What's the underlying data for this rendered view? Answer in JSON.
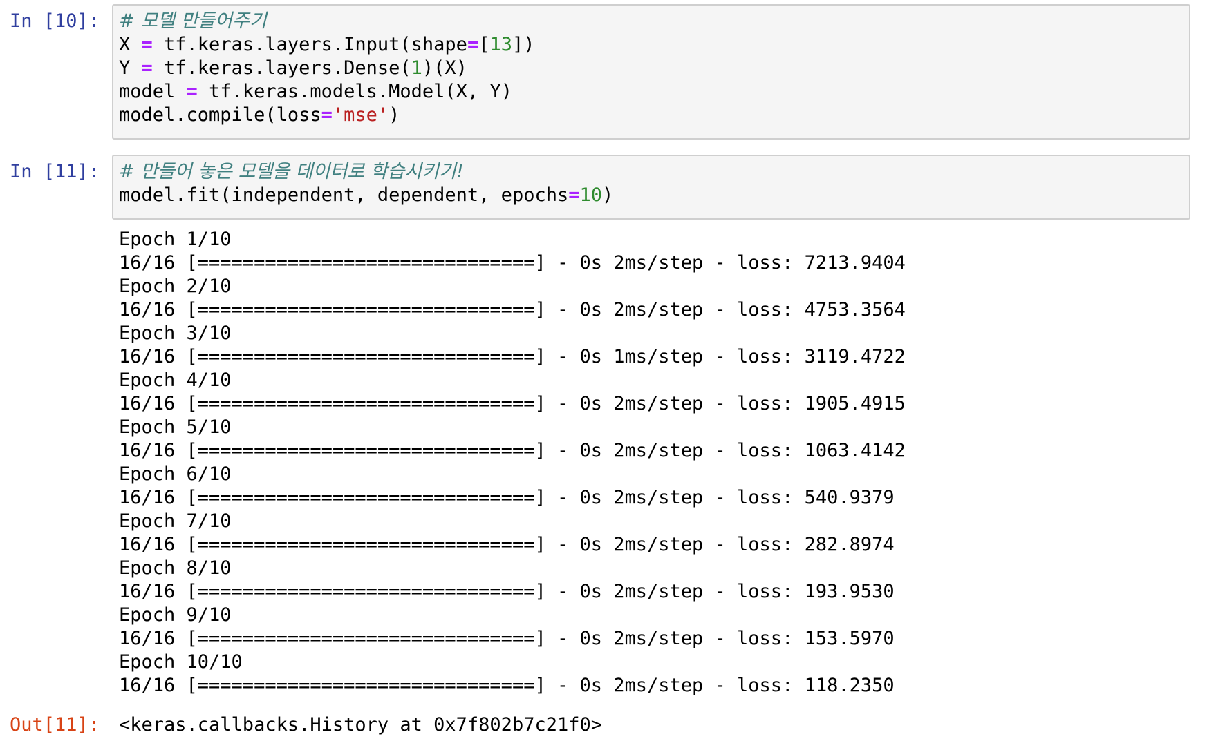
{
  "cells": [
    {
      "prompt": "In [10]:",
      "lines": [
        [
          {
            "t": "# 모델 만들어주기",
            "c": "cm-comment"
          }
        ],
        [
          {
            "t": "X ",
            "c": ""
          },
          {
            "t": "=",
            "c": "cm-op"
          },
          {
            "t": " tf.keras.layers.Input(shape",
            "c": ""
          },
          {
            "t": "=",
            "c": "cm-op"
          },
          {
            "t": "[",
            "c": ""
          },
          {
            "t": "13",
            "c": "cm-num"
          },
          {
            "t": "])",
            "c": ""
          }
        ],
        [
          {
            "t": "Y ",
            "c": ""
          },
          {
            "t": "=",
            "c": "cm-op"
          },
          {
            "t": " tf.keras.layers.Dense(",
            "c": ""
          },
          {
            "t": "1",
            "c": "cm-num"
          },
          {
            "t": ")(X)",
            "c": ""
          }
        ],
        [
          {
            "t": "model ",
            "c": ""
          },
          {
            "t": "=",
            "c": "cm-op"
          },
          {
            "t": " tf.keras.models.Model(X, Y)",
            "c": ""
          }
        ],
        [
          {
            "t": "model.compile(loss",
            "c": ""
          },
          {
            "t": "=",
            "c": "cm-op"
          },
          {
            "t": "'mse'",
            "c": "cm-str"
          },
          {
            "t": ")",
            "c": ""
          }
        ]
      ]
    },
    {
      "prompt": "In [11]:",
      "lines": [
        [
          {
            "t": "# 만들어 놓은 모델을 데이터로 학습시키기!",
            "c": "cm-comment"
          }
        ],
        [
          {
            "t": "model.fit(independent, dependent, epochs",
            "c": ""
          },
          {
            "t": "=",
            "c": "cm-op"
          },
          {
            "t": "10",
            "c": "cm-num"
          },
          {
            "t": ")",
            "c": ""
          }
        ]
      ]
    }
  ],
  "stream_output": [
    "Epoch 1/10",
    "16/16 [==============================] - 0s 2ms/step - loss: 7213.9404",
    "Epoch 2/10",
    "16/16 [==============================] - 0s 2ms/step - loss: 4753.3564",
    "Epoch 3/10",
    "16/16 [==============================] - 0s 1ms/step - loss: 3119.4722",
    "Epoch 4/10",
    "16/16 [==============================] - 0s 2ms/step - loss: 1905.4915",
    "Epoch 5/10",
    "16/16 [==============================] - 0s 2ms/step - loss: 1063.4142",
    "Epoch 6/10",
    "16/16 [==============================] - 0s 2ms/step - loss: 540.9379",
    "Epoch 7/10",
    "16/16 [==============================] - 0s 2ms/step - loss: 282.8974",
    "Epoch 8/10",
    "16/16 [==============================] - 0s 2ms/step - loss: 193.9530",
    "Epoch 9/10",
    "16/16 [==============================] - 0s 2ms/step - loss: 153.5970",
    "Epoch 10/10",
    "16/16 [==============================] - 0s 2ms/step - loss: 118.2350"
  ],
  "result": {
    "prompt": "Out[11]:",
    "text": "<keras.callbacks.History at 0x7f802b7c21f0>"
  }
}
